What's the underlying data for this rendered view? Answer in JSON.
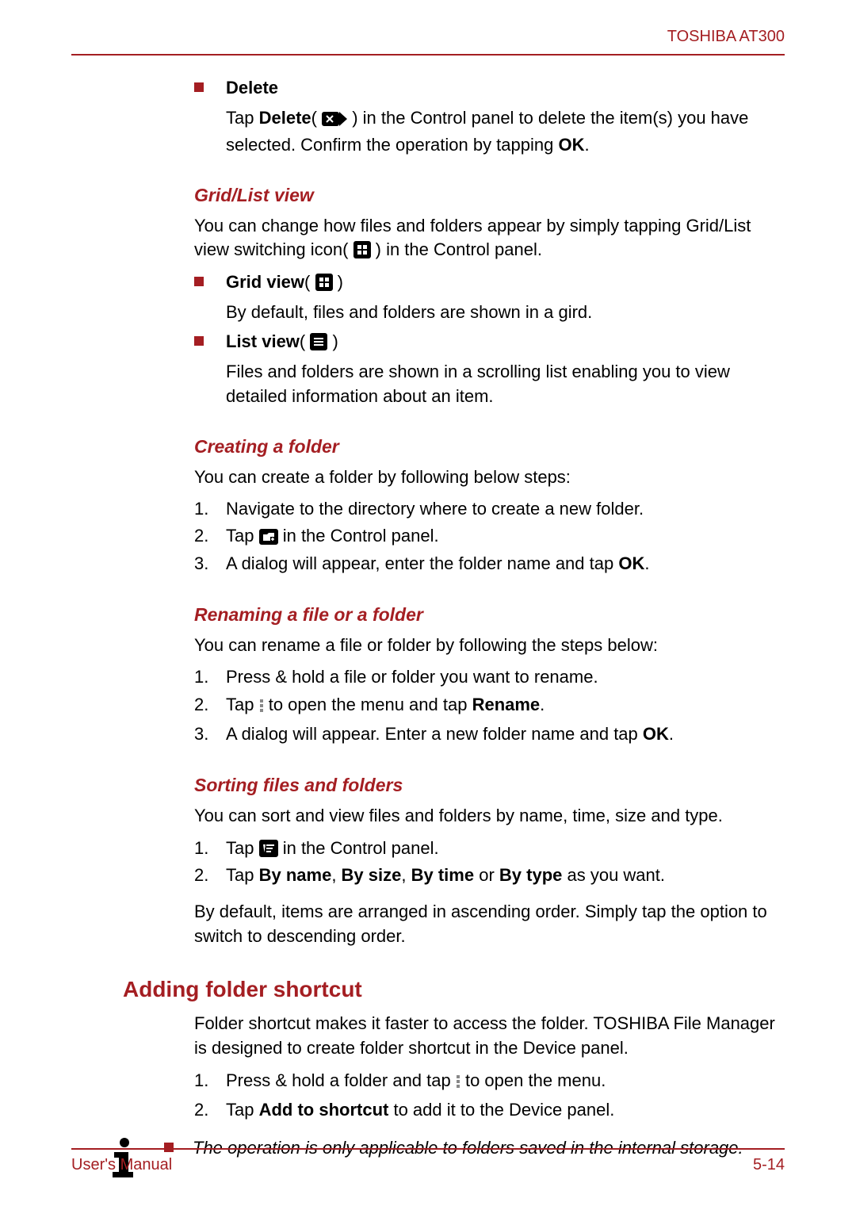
{
  "header": {
    "product": "TOSHIBA AT300"
  },
  "delete_section": {
    "title": "Delete",
    "body_pre": "Tap ",
    "body_bold": "Delete",
    "body_paren_open": "( ",
    "body_paren_close": " ) in the Control panel to delete the item(s) you have selected. Confirm the operation by tapping ",
    "ok": "OK",
    "period": "."
  },
  "gridlist": {
    "heading": "Grid/List view",
    "intro_pre": "You can change how files and folders appear by simply tapping Grid/List view switching icon( ",
    "intro_post": " ) in the Control panel.",
    "grid_label_pre": "Grid view",
    "grid_paren_open": "( ",
    "grid_paren_close": " )",
    "grid_body": "By default, files and folders are shown in a gird.",
    "list_label_pre": "List view",
    "list_paren_open": "( ",
    "list_paren_close": " )",
    "list_body": "Files and folders are shown in a scrolling list enabling you to view detailed information about an item."
  },
  "create": {
    "heading": "Creating a folder",
    "intro": "You can create a folder by following below steps:",
    "s1": "Navigate to the directory where to create a new folder.",
    "s2_pre": "Tap ",
    "s2_post": " in the Control panel.",
    "s3_pre": "A dialog will appear, enter the folder name and tap ",
    "s3_bold": "OK",
    "s3_post": "."
  },
  "rename": {
    "heading": "Renaming a file or a folder",
    "intro": "You can rename a file or folder by following the steps below:",
    "s1": "Press & hold a file or folder you want to rename.",
    "s2_pre": "Tap ",
    "s2_mid": " to open the menu and tap ",
    "s2_bold": "Rename",
    "s2_post": ".",
    "s3_pre": "A dialog will appear. Enter a new folder name and tap ",
    "s3_bold": "OK",
    "s3_post": "."
  },
  "sort": {
    "heading": "Sorting files and folders",
    "intro": "You can sort and view files and folders by name, time, size and type.",
    "s1_pre": "Tap ",
    "s1_post": " in the Control panel.",
    "s2_pre": "Tap ",
    "s2_b1": "By name",
    "s2_c1": ", ",
    "s2_b2": "By size",
    "s2_c2": ", ",
    "s2_b3": "By time",
    "s2_c3": " or ",
    "s2_b4": "By type",
    "s2_post": " as you want.",
    "outro": "By default, items are arranged in ascending order. Simply tap the option to switch to descending order."
  },
  "shortcut": {
    "heading": "Adding folder shortcut",
    "intro": "Folder shortcut makes it faster to access the folder. TOSHIBA File Manager is designed to create folder shortcut in the Device panel.",
    "s1_pre": "Press & hold a folder and tap ",
    "s1_post": " to open the menu.",
    "s2_pre": "Tap ",
    "s2_bold": "Add to shortcut",
    "s2_post": " to add it to the Device panel.",
    "note": "The operation is only applicable to folders saved in the internal storage."
  },
  "footer": {
    "left": "User's Manual",
    "right": "5-14"
  }
}
